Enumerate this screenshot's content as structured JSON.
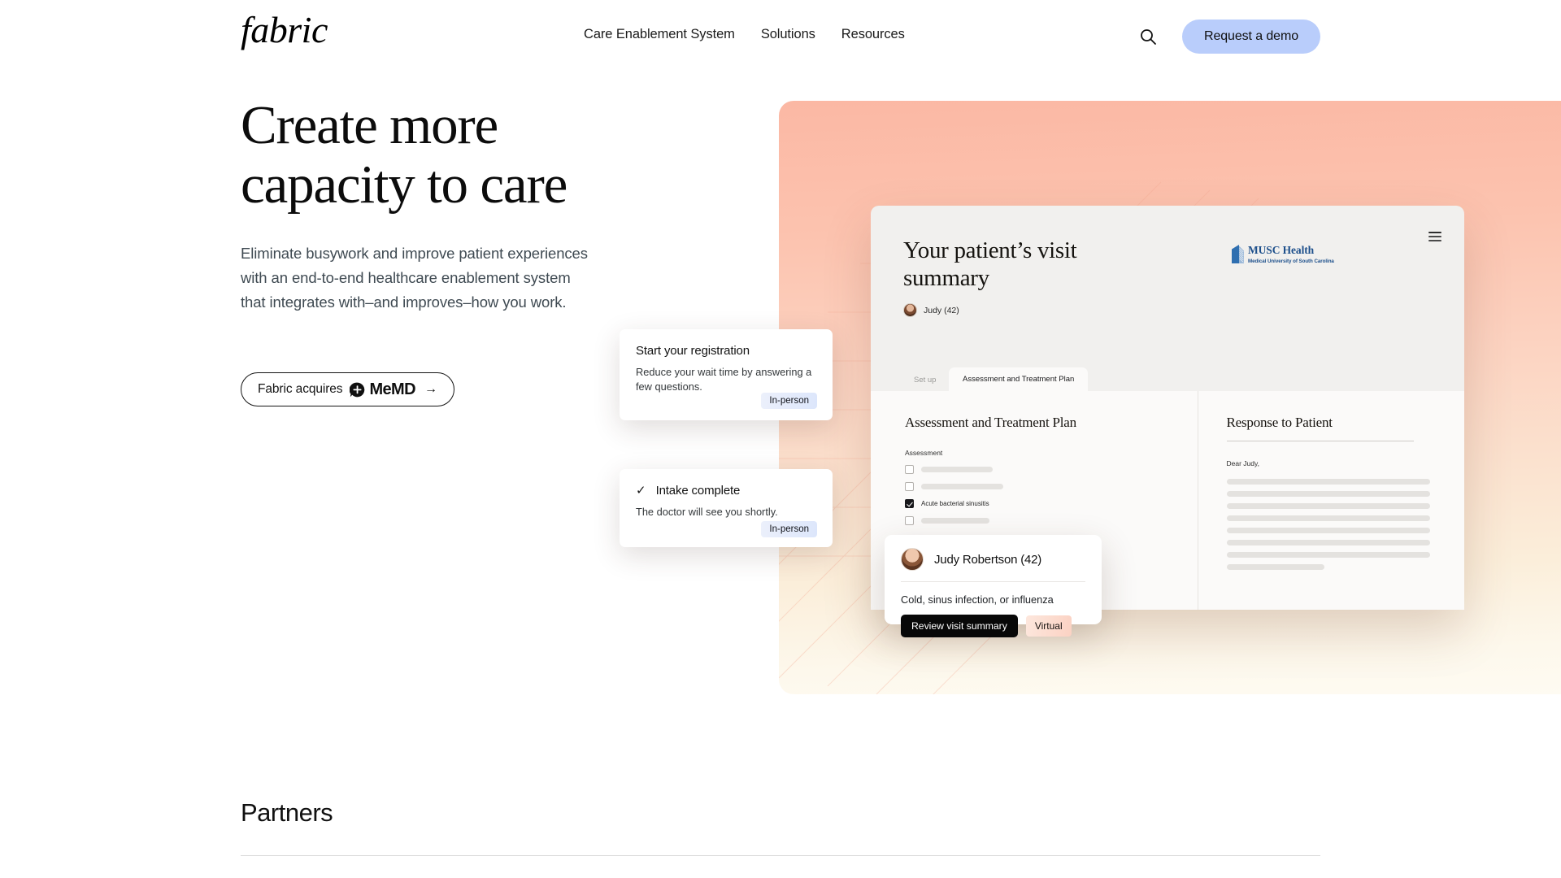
{
  "header": {
    "logo_text": "fabric",
    "nav_items": [
      {
        "label": "Care Enablement System"
      },
      {
        "label": "Solutions"
      },
      {
        "label": "Resources"
      }
    ],
    "search_icon": "search-icon",
    "demo_button": "Request a demo",
    "demo_button_color": "#b9cdfb"
  },
  "hero": {
    "title_line1": "Create more",
    "title_line2": "capacity to care",
    "subtitle": "Eliminate busywork and improve patient experiences with an end-to-end healthcare enablement system that integrates with–and improves–how you work.",
    "cta": {
      "prefix": "Fabric acquires",
      "brand": "MeMD",
      "arrow": "→"
    },
    "panel_gradient_from": "#fbb8a4",
    "panel_gradient_to": "#fefbf2"
  },
  "app_card": {
    "title": "Your patient’s visit summary",
    "org_name": "MUSC Health",
    "org_sub": "Medical University of South Carolina",
    "org_color": "#1d4f8b",
    "patient_mini": "Judy (42)",
    "menu_icon": "hamburger-icon",
    "tabs": [
      {
        "label": "Set up",
        "active": false
      },
      {
        "label": "Assessment and Treatment Plan",
        "active": true
      }
    ],
    "left_panel": {
      "heading": "Assessment and Treatment Plan",
      "field_label": "Assessment",
      "checkboxes": [
        {
          "label": "",
          "checked": false
        },
        {
          "label": "",
          "checked": false
        },
        {
          "label": "Acute bacterial sinusitis",
          "checked": true
        },
        {
          "label": "",
          "checked": false
        }
      ]
    },
    "right_panel": {
      "heading": "Response to Patient",
      "salutation": "Dear Judy,"
    }
  },
  "float_cards": [
    {
      "title": "Start your registration",
      "body": "Reduce your wait time by answering a few questions.",
      "badge": "In-person",
      "check": ""
    },
    {
      "title": "Intake complete",
      "body": "The doctor will see you shortly.",
      "badge": "In-person",
      "check": "✓"
    }
  ],
  "patient_card": {
    "name": "Judy Robertson (42)",
    "reason": "Cold, sinus infection, or influenza",
    "action_button": "Review visit summary",
    "badge": "Virtual",
    "badge_color": "#fbd2c3"
  },
  "partners": {
    "heading": "Partners"
  }
}
